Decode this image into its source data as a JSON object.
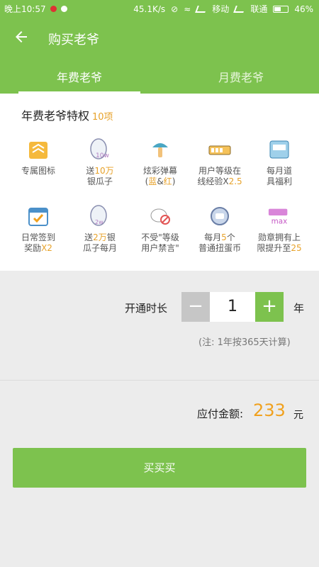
{
  "status_bar": {
    "time": "晚上10:57",
    "network_speed": "45.1K/s",
    "carrier1": "移动",
    "carrier2": "联通",
    "battery": "46%"
  },
  "app_bar": {
    "title": "购买老爷"
  },
  "tabs": [
    {
      "label": "年费老爷",
      "active": true
    },
    {
      "label": "月费老爷",
      "active": false
    }
  ],
  "privileges": {
    "title": "年费老爷特权",
    "count": "10项",
    "items": [
      {
        "icon": "exclusive-badge-icon",
        "line1": "专属图标",
        "line2": ""
      },
      {
        "icon": "silver-melon-seeds-icon",
        "line1a": "送",
        "line1b": "10万",
        "line2": "银瓜子"
      },
      {
        "icon": "danmaku-mushroom-icon",
        "line1": "炫彩弹幕",
        "line2a": "(",
        "line2b": "蓝",
        "line2c": "&",
        "line2d": "红",
        "line2e": ")"
      },
      {
        "icon": "level-bar-icon",
        "line1": "用户等级在",
        "line2a": "线经验X",
        "line2b": "2.5"
      },
      {
        "icon": "monthly-gift-icon",
        "line1": "每月道",
        "line2": "具福利"
      },
      {
        "icon": "calendar-check-icon",
        "line1": "日常签到",
        "line2a": "奖励",
        "line2b": "X2"
      },
      {
        "icon": "silver-2w-icon",
        "line1a": "送",
        "line1b": "2万",
        "line1c": "银",
        "line2": "瓜子每月"
      },
      {
        "icon": "no-ban-icon",
        "line1": "不受\"等级",
        "line2": "用户禁言\""
      },
      {
        "icon": "gacha-coin-icon",
        "line1a": "每月",
        "line1b": "5",
        "line1c": "个",
        "line2": "普通扭蛋币"
      },
      {
        "icon": "medal-max-icon",
        "line1": "勋章拥有上",
        "line2a": "限提升至",
        "line2b": "25"
      }
    ]
  },
  "purchase": {
    "duration_label": "开通时长",
    "minus": "−",
    "quantity": "1",
    "plus": "+",
    "unit": "年",
    "note": "(注:  1年按365天计算)"
  },
  "payment": {
    "label": "应付金额:",
    "amount": "233",
    "unit": "元"
  },
  "buy_button": {
    "label": "买买买"
  },
  "colors": {
    "primary": "#7dc24e",
    "accent": "#f0a11e"
  }
}
